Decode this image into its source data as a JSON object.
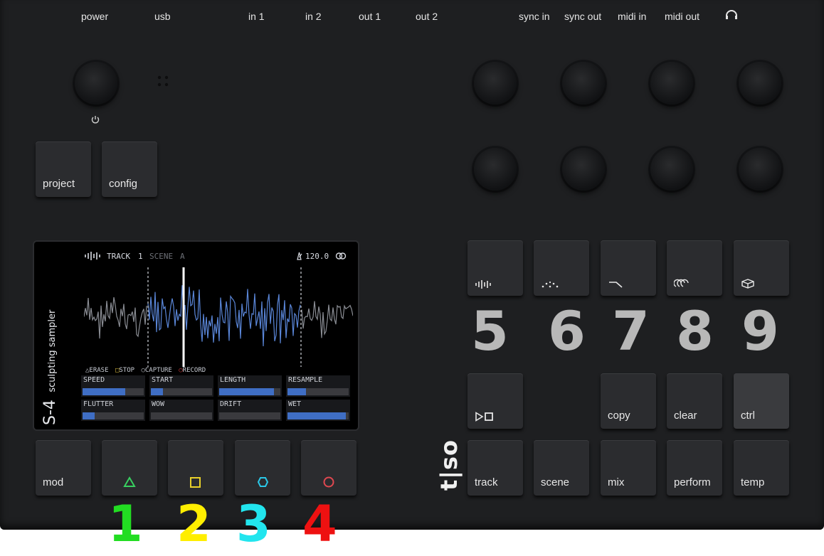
{
  "ports": [
    "power",
    "usb",
    "in 1",
    "in 2",
    "out 1",
    "out 2",
    "sync in",
    "sync out",
    "midi in",
    "midi out"
  ],
  "icons": {
    "headphone": "headphone-icon",
    "power": "power-icon"
  },
  "top_buttons": {
    "project": "project",
    "config": "config"
  },
  "screen": {
    "track": "TRACK",
    "track_num": "1",
    "scene": "SCENE",
    "scene_id": "A",
    "bpm": "120.0",
    "side_model": "S-4",
    "side_desc": "sculpting sampler",
    "legend": [
      "ERASE",
      "STOP",
      "CAPTURE",
      "RECORD"
    ],
    "params": [
      {
        "name": "SPEED",
        "value": 0.7
      },
      {
        "name": "START",
        "value": 0.2
      },
      {
        "name": "LENGTH",
        "value": 0.9
      },
      {
        "name": "RESAMPLE",
        "value": 0.3
      },
      {
        "name": "FLUTTER",
        "value": 0.2
      },
      {
        "name": "WOW",
        "value": 0.0
      },
      {
        "name": "DRIFT",
        "value": 0.0
      },
      {
        "name": "WET",
        "value": 0.95
      }
    ]
  },
  "bottom_left": {
    "mod": "mod"
  },
  "right_keys": {
    "copy": "copy",
    "clear": "clear",
    "ctrl": "ctrl",
    "track": "track",
    "scene": "scene",
    "mix": "mix",
    "perform": "perform",
    "temp": "temp"
  },
  "brand": "t|so",
  "overlay_numbers": [
    {
      "text": "1",
      "color": "#22dd22"
    },
    {
      "text": "2",
      "color": "#ffee00"
    },
    {
      "text": "3",
      "color": "#22e5ee"
    },
    {
      "text": "4",
      "color": "#ee1111"
    },
    {
      "text": "5",
      "color": "#b8b8b8"
    },
    {
      "text": "6",
      "color": "#b8b8b8"
    },
    {
      "text": "7",
      "color": "#b8b8b8"
    },
    {
      "text": "8",
      "color": "#b8b8b8"
    },
    {
      "text": "9",
      "color": "#b8b8b8"
    }
  ],
  "colors": {
    "accent_blue": "#3f6ec4",
    "device": "#1e1f21"
  }
}
